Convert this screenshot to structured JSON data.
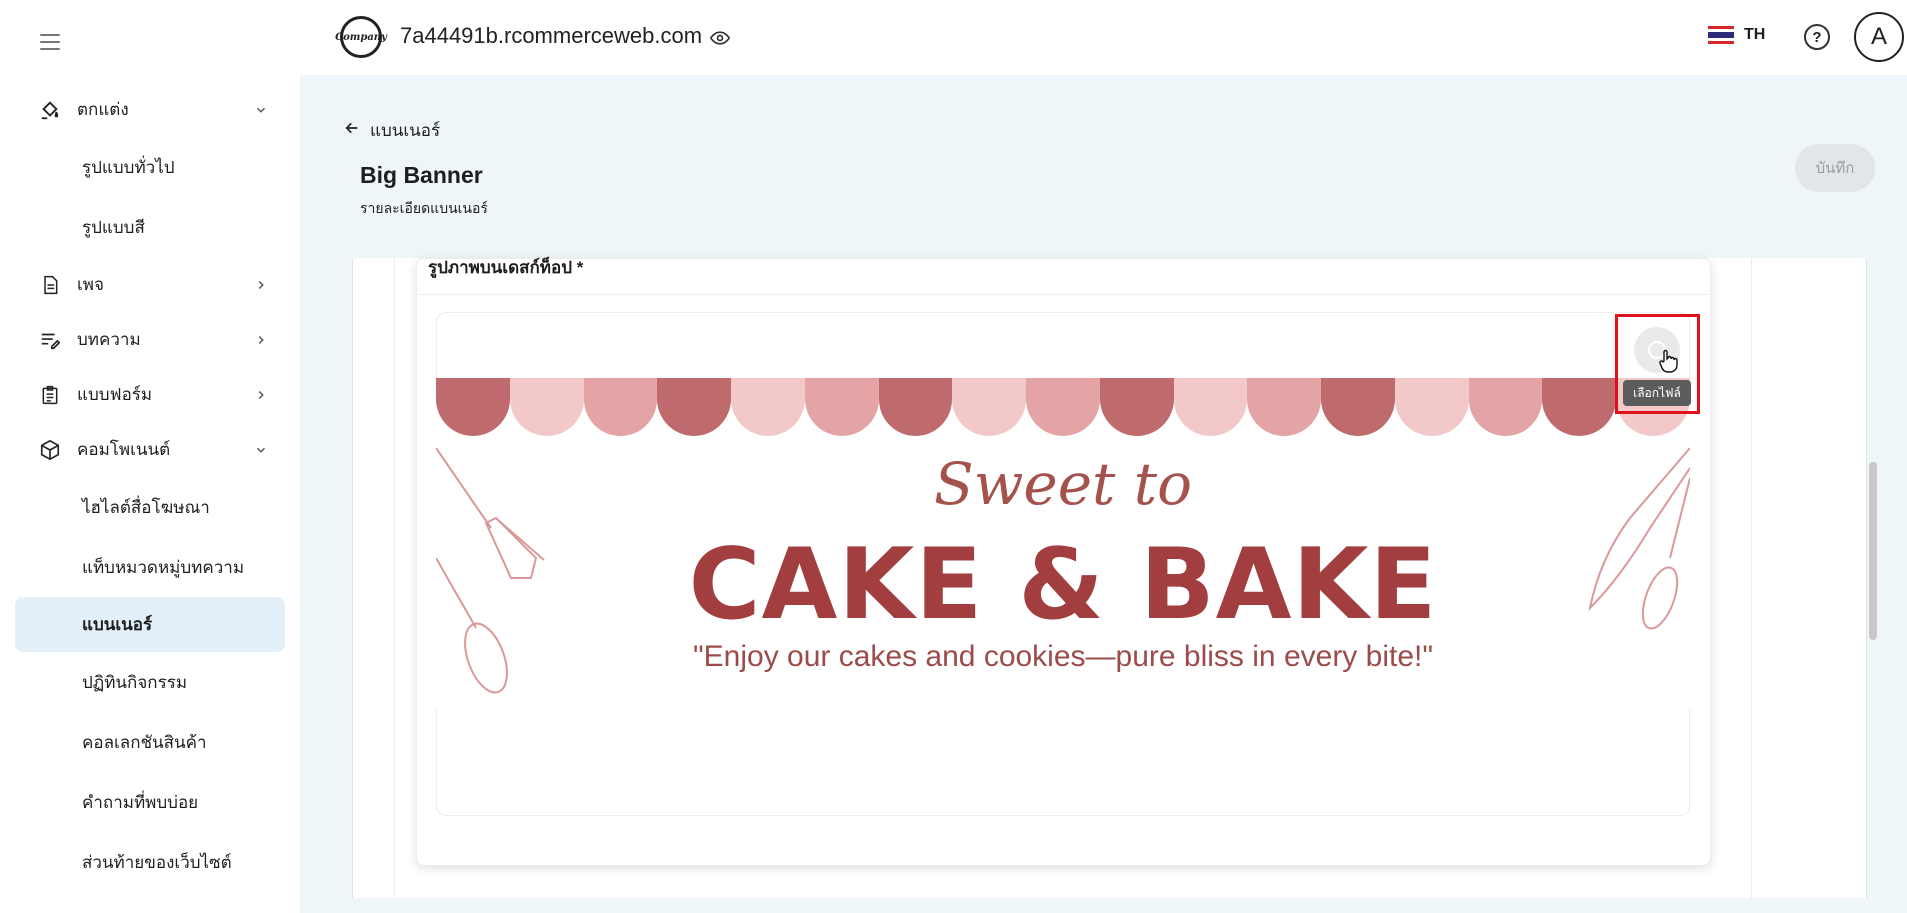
{
  "header": {
    "logo_text": "Company",
    "domain": "7a44491b.rcommerceweb.com",
    "language": "TH",
    "help_symbol": "?",
    "avatar_initial": "A"
  },
  "sidebar": {
    "items": [
      {
        "label": "ตกแต่ง",
        "icon": "paint-bucket-icon",
        "expanded": true
      },
      {
        "label": "รูปแบบทั่วไป"
      },
      {
        "label": "รูปแบบสี"
      },
      {
        "label": "เพจ",
        "icon": "page-icon"
      },
      {
        "label": "บทความ",
        "icon": "article-icon"
      },
      {
        "label": "แบบฟอร์ม",
        "icon": "form-icon"
      },
      {
        "label": "คอมโพเนนต์",
        "icon": "box-icon",
        "expanded": true
      },
      {
        "label": "ไฮไลต์สื่อโฆษณา"
      },
      {
        "label": "แท็บหมวดหมู่บทความ"
      },
      {
        "label": "แบนเนอร์",
        "active": true
      },
      {
        "label": "ปฏิทินกิจกรรม"
      },
      {
        "label": "คอลเลกชันสินค้า"
      },
      {
        "label": "คำถามที่พบบ่อย"
      },
      {
        "label": "ส่วนท้ายของเว็บไซต์"
      }
    ]
  },
  "content": {
    "back_label": "แบนเนอร์",
    "title": "Big Banner",
    "subtitle": "รายละเอียดแบนเนอร์",
    "save_label": "บันทึก",
    "field_label": "รูปภาพบนเดสก์ท็อป *",
    "select_file_tooltip": "เลือกไฟล์"
  },
  "banner": {
    "script_text": "Sweet to",
    "headline": "CAKE & BAKE",
    "tagline": "\"Enjoy our cakes and cookies—pure bliss in every bite!\"",
    "colors": {
      "awning_dark": "#bf6b6e",
      "awning_mid": "#e4a3a4",
      "awning_light": "#f2c8c8",
      "headline": "#a23e3f"
    }
  },
  "colors": {
    "active_nav_bg": "#e3f0fa",
    "content_bg": "#eef6fa",
    "highlight_box": "#e0101c"
  }
}
